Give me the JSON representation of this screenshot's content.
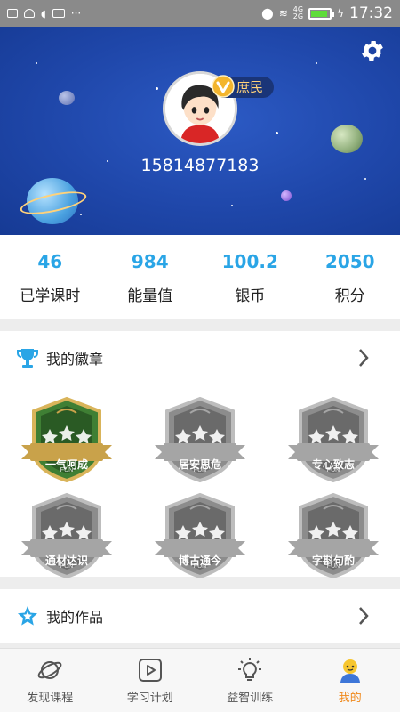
{
  "status_bar": {
    "time": "17:32",
    "net_top": "4G",
    "net_bottom": "2G"
  },
  "profile": {
    "level_name": "庶民",
    "phone": "15814877183"
  },
  "stats": [
    {
      "value": "46",
      "label": "已学课时"
    },
    {
      "value": "984",
      "label": "能量值"
    },
    {
      "value": "100.2",
      "label": "银币"
    },
    {
      "value": "2050",
      "label": "积分"
    }
  ],
  "badges_section": {
    "title": "我的徽章",
    "items": [
      {
        "name": "一气呵成",
        "earned": true
      },
      {
        "name": "居安思危",
        "earned": false
      },
      {
        "name": "专心致志",
        "earned": false
      },
      {
        "name": "通材达识",
        "earned": false
      },
      {
        "name": "博古通今",
        "earned": false
      },
      {
        "name": "字斟句酌",
        "earned": false
      }
    ],
    "badge_sub": "FUN"
  },
  "works_section": {
    "title": "我的作品"
  },
  "tabs": [
    {
      "label": "发现课程",
      "icon": "planet-icon",
      "active": false
    },
    {
      "label": "学习计划",
      "icon": "play-icon",
      "active": false
    },
    {
      "label": "益智训练",
      "icon": "bulb-icon",
      "active": false
    },
    {
      "label": "我的",
      "icon": "profile-icon",
      "active": true
    }
  ],
  "colors": {
    "accent": "#2aa5e6",
    "active_tab": "#f08a1d",
    "hero_bg": "#1f47aa",
    "badge_gold": "#c9a24a",
    "badge_green": "#2f6b2b"
  }
}
